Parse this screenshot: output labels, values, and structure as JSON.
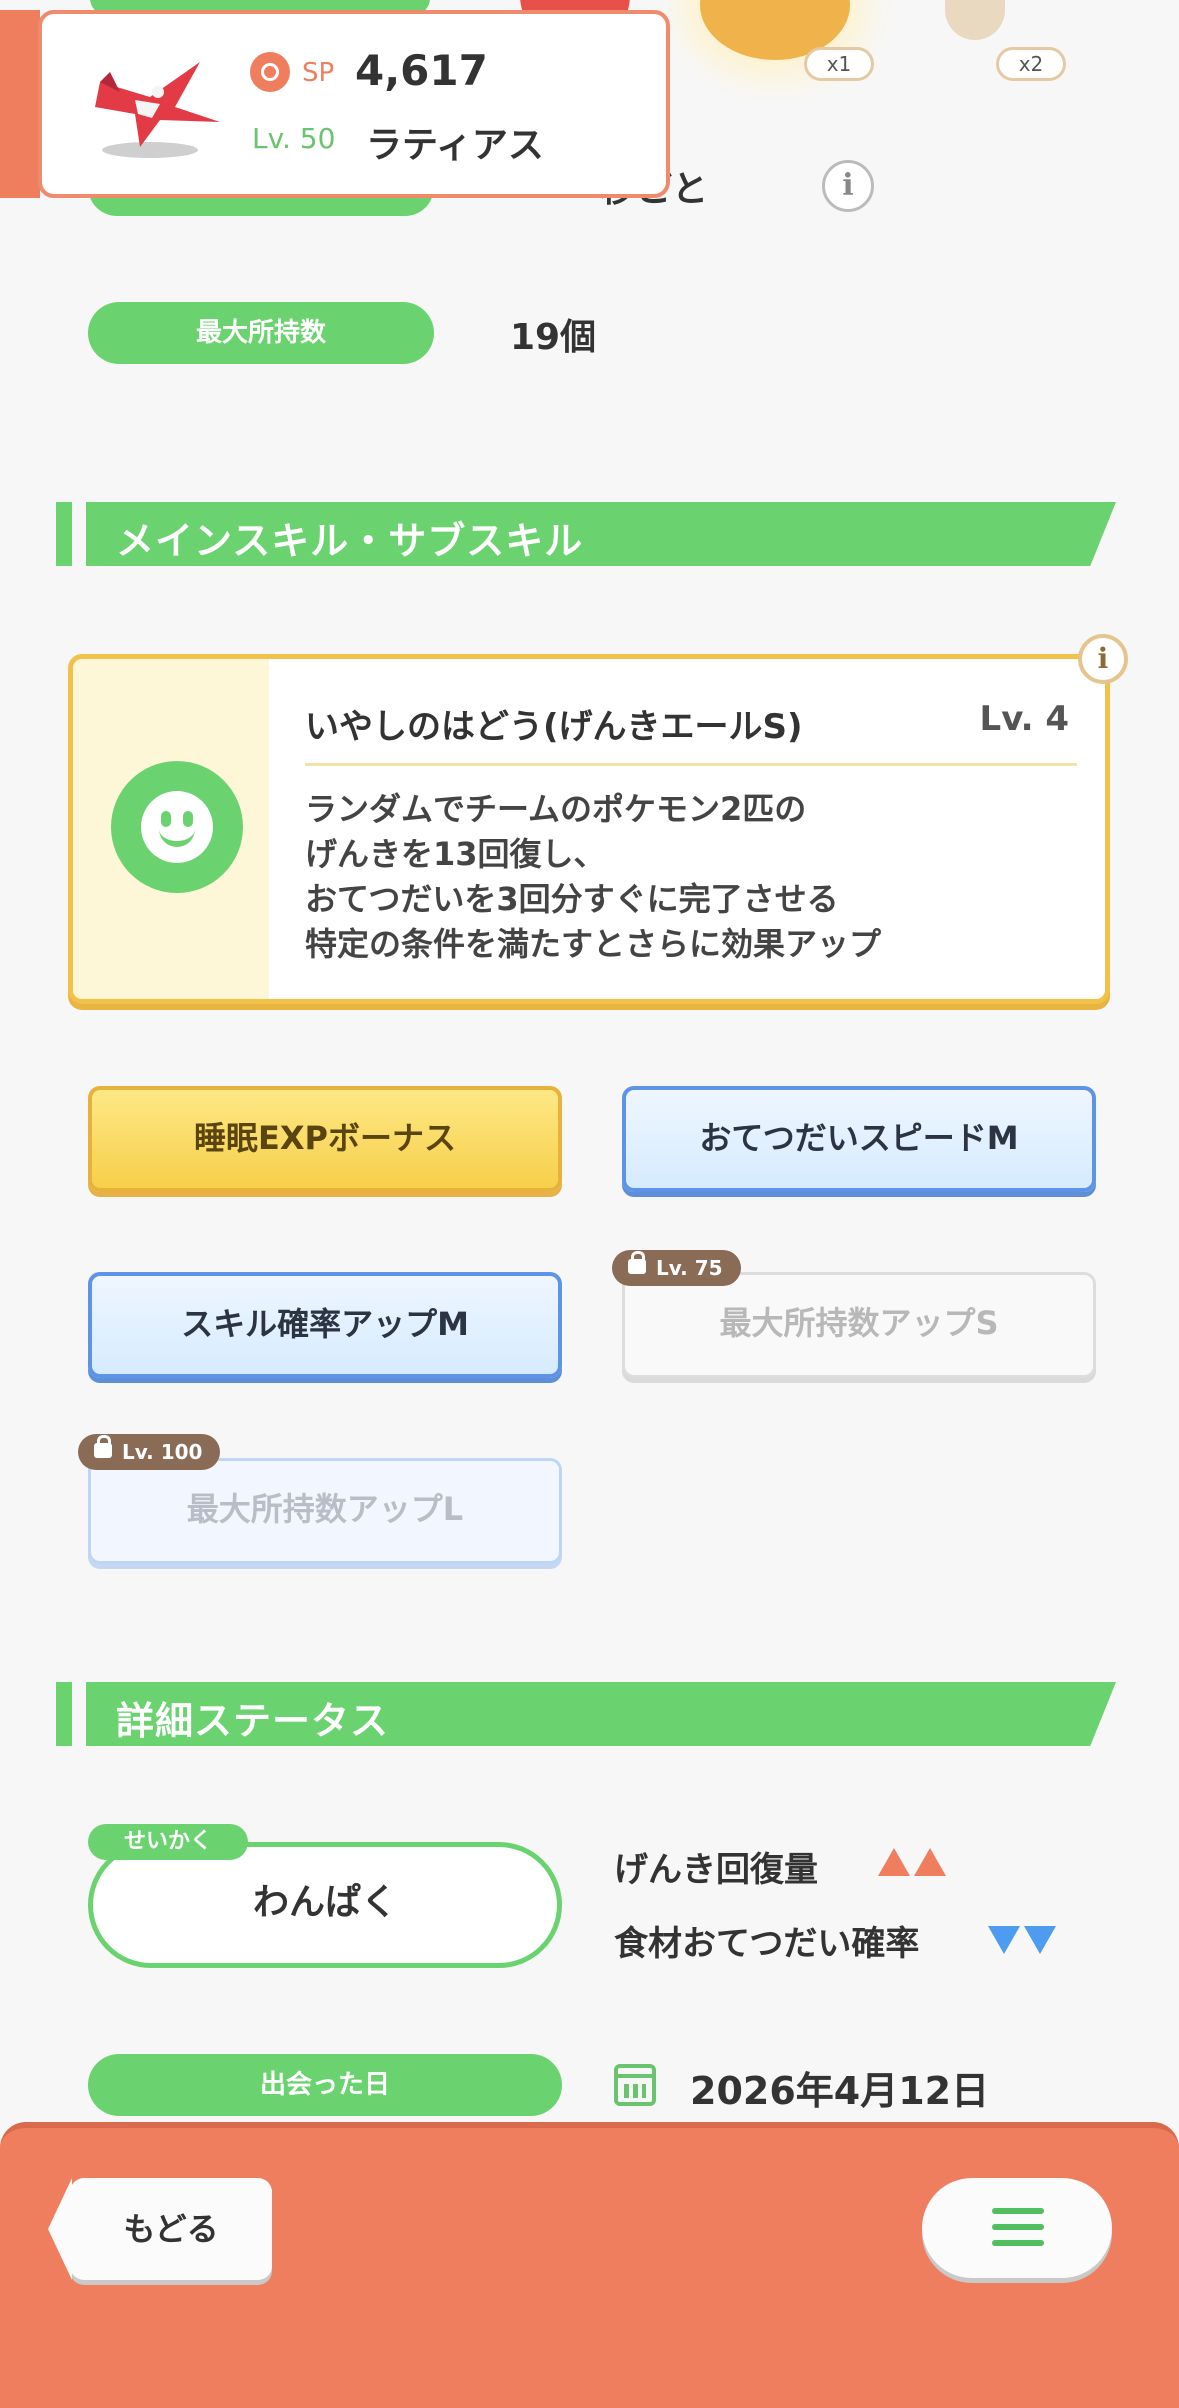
{
  "top": {
    "ingredient_counts": [
      "x1",
      "x2"
    ],
    "interval_text": "秒ごと",
    "max_carry_label": "最大所持数",
    "max_carry_value": "19個"
  },
  "overlay": {
    "sp_label": "SP",
    "sp_value": "4,617",
    "level": "Lv. 50",
    "name": "ラティアス"
  },
  "skills": {
    "section_title": "メインスキル・サブスキル",
    "main": {
      "name": "いやしのはどう(げんきエールS)",
      "level": "Lv. 4",
      "description": [
        "ランダムでチームのポケモン2匹の",
        "げんきを13回復し、",
        "おてつだいを3回分すぐに完了させる",
        "特定の条件を満たすとさらに効果アップ"
      ]
    },
    "sub": [
      {
        "label": "睡眠EXPボーナス",
        "lock": ""
      },
      {
        "label": "おてつだいスピードM",
        "lock": ""
      },
      {
        "label": "スキル確率アップM",
        "lock": ""
      },
      {
        "label": "最大所持数アップS",
        "lock": "Lv. 75"
      },
      {
        "label": "最大所持数アップL",
        "lock": "Lv. 100"
      }
    ]
  },
  "details": {
    "section_title": "詳細ステータス",
    "nature_tag": "せいかく",
    "nature": "わんぱく",
    "up_stat": "げんき回復量",
    "down_stat": "食材おてつだい確率",
    "met_label": "出会った日",
    "met_date": "2026年4月12日"
  },
  "nav": {
    "back_label": "もどる"
  },
  "colors": {
    "accent_green": "#6ad36f",
    "accent_orange": "#ef7e5f",
    "skill_gold": "#f2c14a",
    "skill_blue": "#5d94e8"
  }
}
